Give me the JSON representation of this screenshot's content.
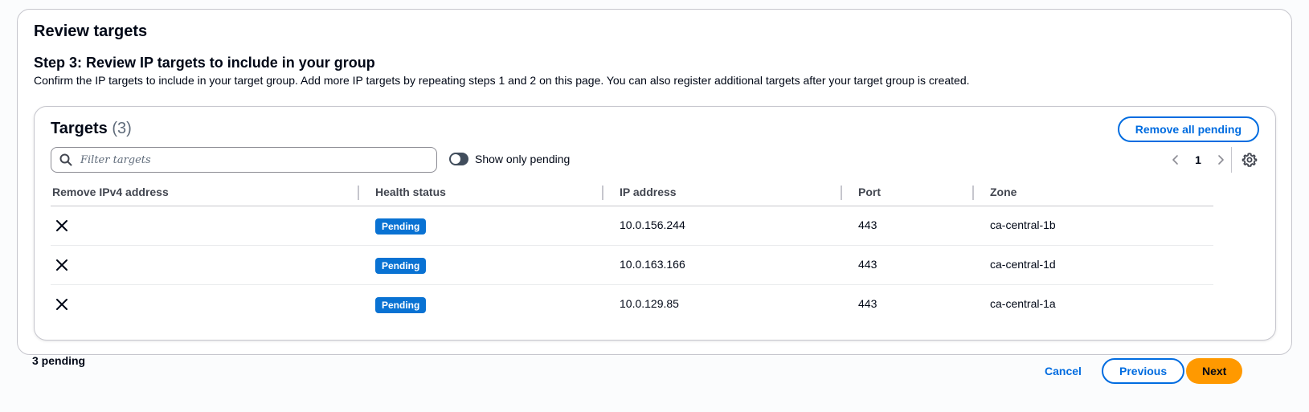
{
  "panel": {
    "title": "Review targets",
    "step_title": "Step 3: Review IP targets to include in your group",
    "step_description": "Confirm the IP targets to include in your target group. Add more IP targets by repeating steps 1 and 2 on this page. You can also register additional targets after your target group is created."
  },
  "targets": {
    "title": "Targets",
    "count": "(3)",
    "remove_all_label": "Remove all pending",
    "filter_placeholder": "Filter targets",
    "toggle_label": "Show only pending",
    "current_page": "1",
    "columns": [
      "Remove IPv4 address",
      "Health status",
      "IP address",
      "Port",
      "Zone"
    ],
    "rows": [
      {
        "health": "Pending",
        "ip": "10.0.156.244",
        "port": "443",
        "zone": "ca-central-1b"
      },
      {
        "health": "Pending",
        "ip": "10.0.163.166",
        "port": "443",
        "zone": "ca-central-1d"
      },
      {
        "health": "Pending",
        "ip": "10.0.129.85",
        "port": "443",
        "zone": "ca-central-1a"
      }
    ]
  },
  "footer": {
    "pending_text": "3 pending",
    "cancel_label": "Cancel",
    "previous_label": "Previous",
    "next_label": "Next"
  },
  "colors": {
    "link_blue": "#006ce0",
    "badge_blue": "#0972d3",
    "primary_orange": "#ff9900",
    "text_dark": "#000716"
  },
  "icons": {
    "search": "search-icon",
    "remove": "close-icon",
    "prev": "chevron-left-icon",
    "next": "chevron-right-icon",
    "settings": "gear-icon"
  }
}
